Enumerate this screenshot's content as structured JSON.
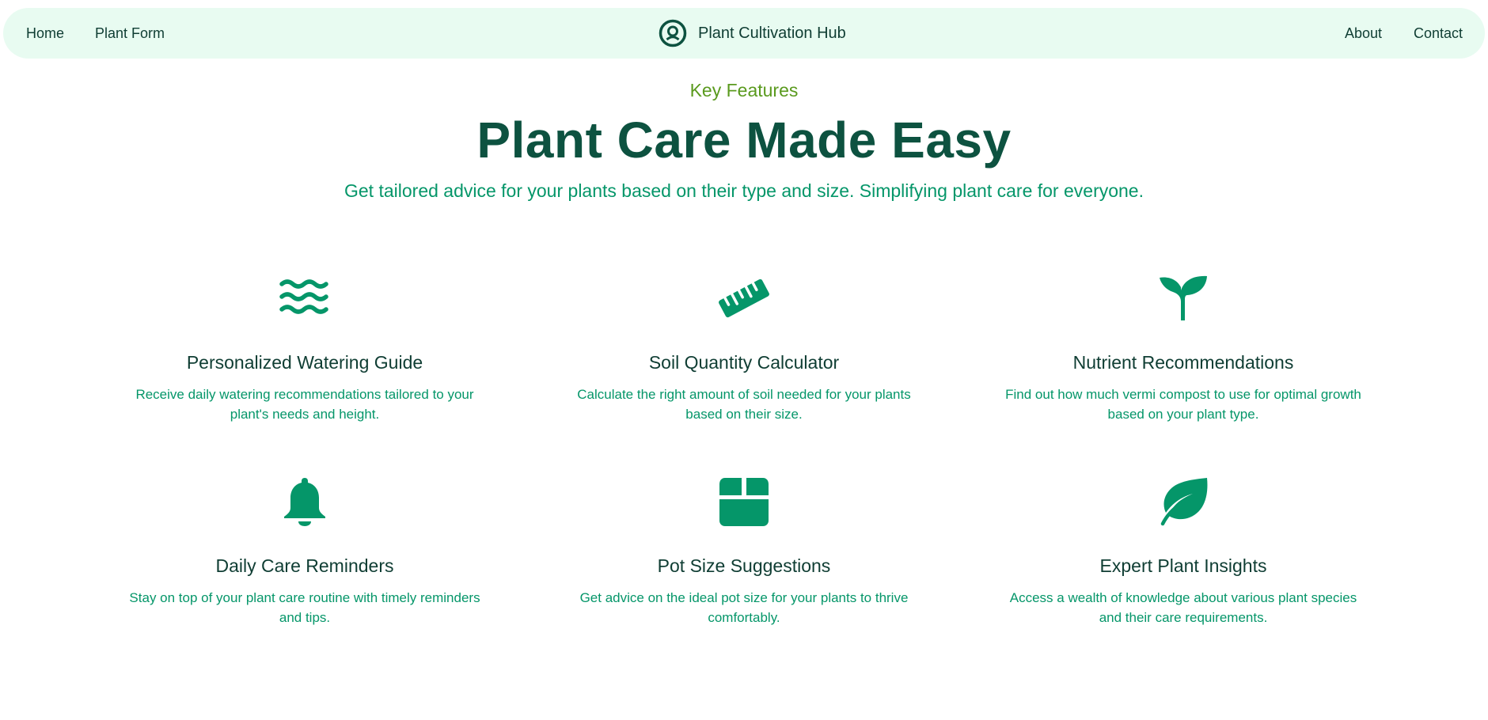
{
  "nav": {
    "home": "Home",
    "plant_form": "Plant Form",
    "brand": "Plant Cultivation Hub",
    "about": "About",
    "contact": "Contact"
  },
  "hero": {
    "eyebrow": "Key Features",
    "title": "Plant Care Made Easy",
    "subtitle": "Get tailored advice for your plants based on their type and size. Simplifying plant care for everyone."
  },
  "features": [
    {
      "icon": "water-waves-icon",
      "title": "Personalized Watering Guide",
      "desc": "Receive daily watering recommendations tailored to your plant's needs and height."
    },
    {
      "icon": "ruler-icon",
      "title": "Soil Quantity Calculator",
      "desc": "Calculate the right amount of soil needed for your plants based on their size."
    },
    {
      "icon": "seedling-icon",
      "title": "Nutrient Recommendations",
      "desc": "Find out how much vermi compost to use for optimal growth based on your plant type."
    },
    {
      "icon": "bell-icon",
      "title": "Daily Care Reminders",
      "desc": "Stay on top of your plant care routine with timely reminders and tips."
    },
    {
      "icon": "box-icon",
      "title": "Pot Size Suggestions",
      "desc": "Get advice on the ideal pot size for your plants to thrive comfortably."
    },
    {
      "icon": "leaf-icon",
      "title": "Expert Plant Insights",
      "desc": "Access a wealth of knowledge about various plant species and their care requirements."
    }
  ],
  "colors": {
    "accent": "#059669",
    "heading": "#0d5240",
    "eyebrow": "#5a9a1e",
    "nav_bg": "#e8fbf1"
  }
}
